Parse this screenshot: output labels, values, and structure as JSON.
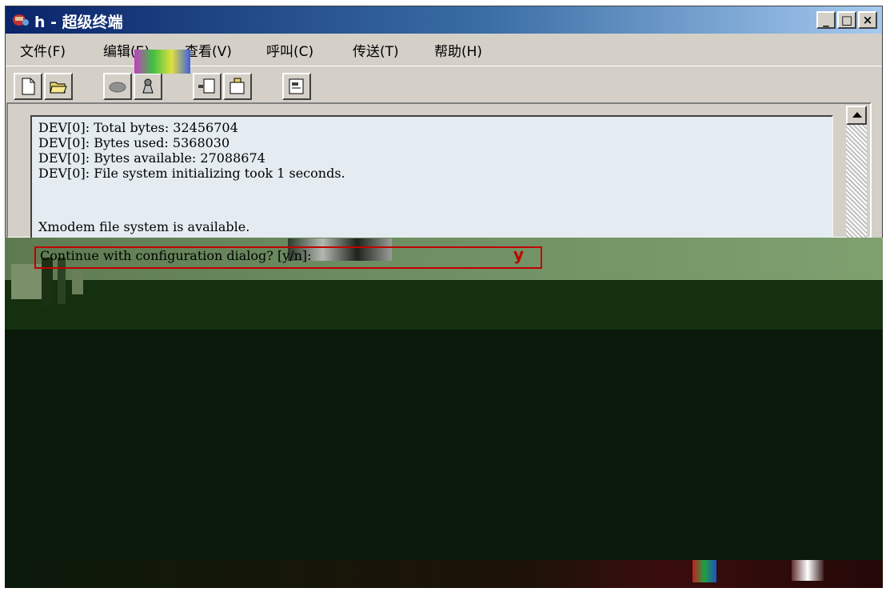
{
  "window": {
    "title": "h - 超级终端",
    "controls": {
      "minimize": "_",
      "maximize": "□",
      "close": "×"
    }
  },
  "menu": [
    "文件(F)",
    "编辑(E)",
    "查看(V)",
    "呼叫(C)",
    "传送(T)",
    "帮助(H)"
  ],
  "toolbar": {
    "buttons": [
      "new-icon",
      "open-icon",
      "connect-icon",
      "disconnect-icon",
      "send-icon",
      "receive-icon",
      "properties-icon"
    ]
  },
  "terminal": {
    "lines": [
      "DEV[0]: Total bytes: 32456704",
      "DEV[0]: Bytes used: 5368030",
      "DEV[0]: Bytes available: 27088674",
      "DEV[0]: File system initializing took 1 seconds.",
      "",
      "Xmodem file system is available."
    ],
    "prompt": "Continue with configuration dialog? [y/n]:",
    "answer": "y"
  },
  "colors": {
    "titlebar_start": "#0a246a",
    "titlebar_end": "#a6caf0",
    "terminal_bg": "#e4ecf1",
    "highlight": "#c00000"
  }
}
